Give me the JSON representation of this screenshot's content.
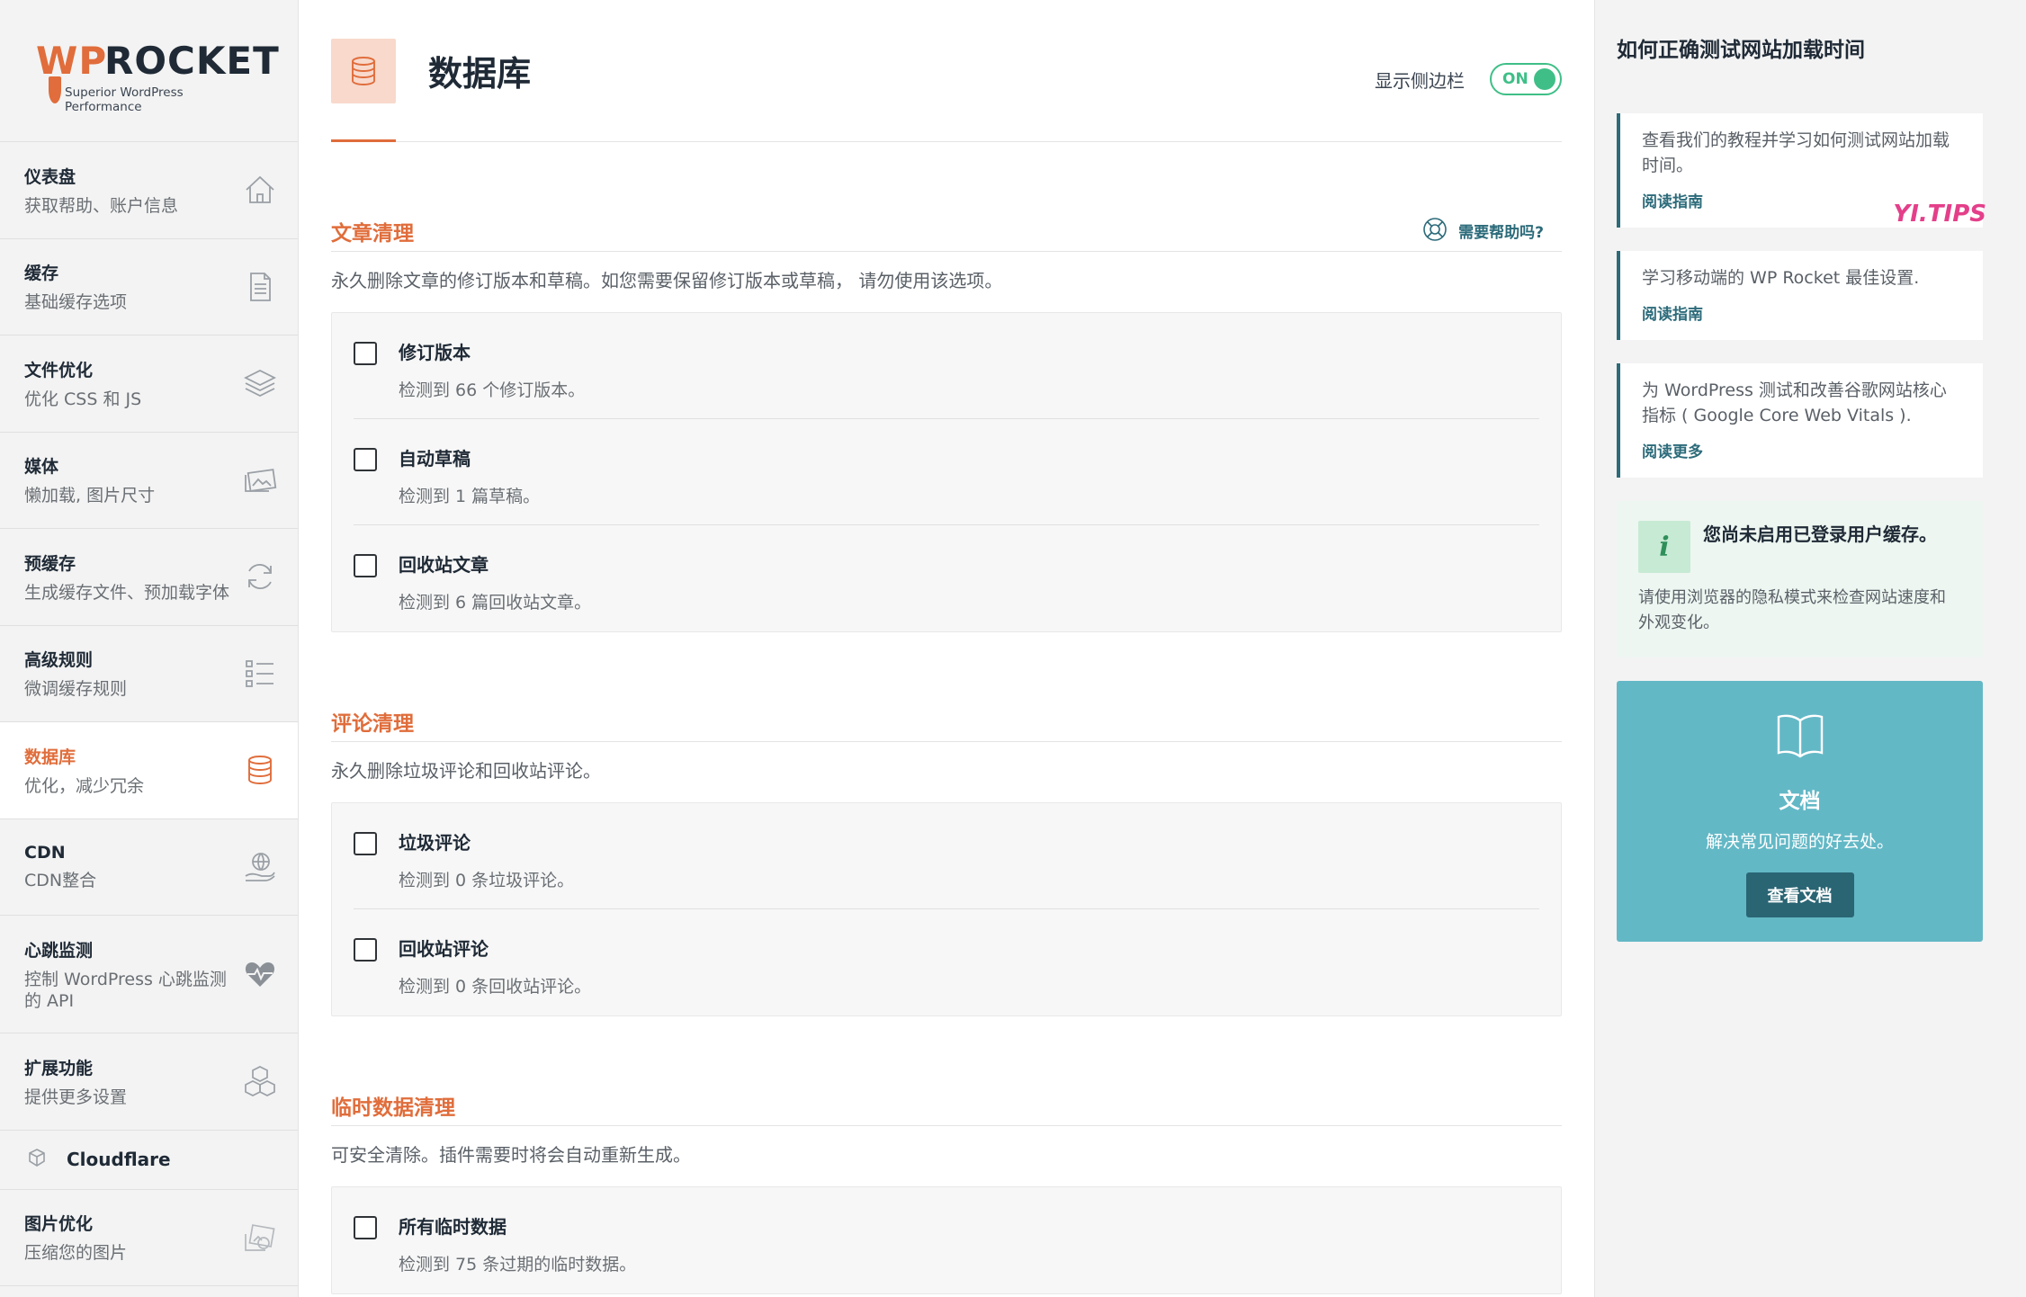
{
  "brand": {
    "wp": "WP",
    "rocket": "ROCKET",
    "tagline": "Superior WordPress Performance",
    "accent": "#e06d3b"
  },
  "sidebar": {
    "items": [
      {
        "title": "仪表盘",
        "sub": "获取帮助、账户信息",
        "icon": "home-icon"
      },
      {
        "title": "缓存",
        "sub": "基础缓存选项",
        "icon": "file-icon"
      },
      {
        "title": "文件优化",
        "sub": "优化 CSS 和 JS",
        "icon": "layers-icon"
      },
      {
        "title": "媒体",
        "sub": "懒加载, 图片尺寸",
        "icon": "images-icon"
      },
      {
        "title": "预缓存",
        "sub": "生成缓存文件、预加载字体",
        "icon": "refresh-icon"
      },
      {
        "title": "高级规则",
        "sub": "微调缓存规则",
        "icon": "list-icon"
      },
      {
        "title": "数据库",
        "sub": "优化，减少冗余",
        "icon": "database-icon",
        "active": true
      },
      {
        "title": "CDN",
        "sub": "CDN整合",
        "icon": "globe-hand-icon"
      },
      {
        "title": "心跳监测",
        "sub": "控制 WordPress 心跳监测的 API",
        "icon": "heartbeat-icon"
      },
      {
        "title": "扩展功能",
        "sub": "提供更多设置",
        "icon": "cubes-icon"
      },
      {
        "title": "Cloudflare",
        "icon": "cloudflare-cube-icon"
      },
      {
        "title": "图片优化",
        "sub": "压缩您的图片",
        "icon": "image-compress-icon"
      }
    ]
  },
  "header": {
    "title": "数据库",
    "toggle_label": "显示侧边栏",
    "toggle_state": "ON"
  },
  "help": {
    "label": "需要帮助吗?"
  },
  "sections": [
    {
      "title": "文章清理",
      "desc": "永久删除文章的修订版本和草稿。如您需要保留修订版本或草稿， 请勿使用该选项。",
      "options": [
        {
          "title": "修订版本",
          "sub": "检测到 66 个修订版本。",
          "checked": false
        },
        {
          "title": "自动草稿",
          "sub": "检测到 1 篇草稿。",
          "checked": false
        },
        {
          "title": "回收站文章",
          "sub": "检测到 6 篇回收站文章。",
          "checked": false
        }
      ]
    },
    {
      "title": "评论清理",
      "desc": "永久删除垃圾评论和回收站评论。",
      "options": [
        {
          "title": "垃圾评论",
          "sub": "检测到 0 条垃圾评论。",
          "checked": false
        },
        {
          "title": "回收站评论",
          "sub": "检测到 0 条回收站评论。",
          "checked": false
        }
      ]
    },
    {
      "title": "临时数据清理",
      "desc": "可安全清除。插件需要时将会自动重新生成。",
      "options": [
        {
          "title": "所有临时数据",
          "sub": "检测到 75 条过期的临时数据。",
          "checked": false
        }
      ]
    }
  ],
  "right": {
    "title": "如何正确测试网站加载时间",
    "tips": [
      {
        "text": "查看我们的教程并学习如何测试网站加载时间。",
        "link": "阅读指南"
      },
      {
        "text": "学习移动端的 WP Rocket 最佳设置.",
        "link": "阅读指南"
      },
      {
        "text": "为 WordPress 测试和改善谷歌网站核心指标 ( Google Core Web Vitals ).",
        "link": "阅读更多"
      }
    ],
    "watermark": "YI.TIPS",
    "notice": {
      "icon_letter": "i",
      "title": "您尚未启用已登录用户缓存。",
      "body": "请使用浏览器的隐私模式来检查网站速度和外观变化。"
    },
    "docs": {
      "title": "文档",
      "sub": "解决常见问题的好去处。",
      "button": "查看文档"
    }
  }
}
